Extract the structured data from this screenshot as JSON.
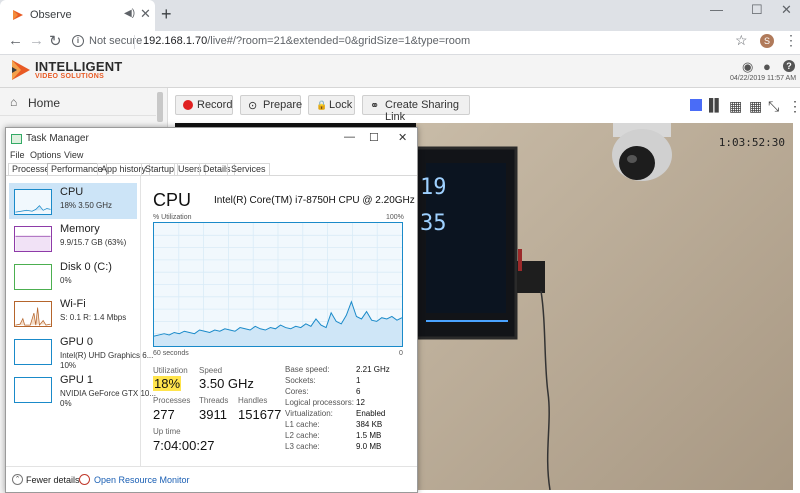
{
  "browser": {
    "tab_title": "Observe",
    "new_tab_glyph": "+",
    "tab_close_glyph": "✕",
    "audio_glyph": "◀)",
    "window_controls": [
      "—",
      "☐",
      "✕"
    ],
    "nav": {
      "back": "←",
      "forward": "→",
      "reload": "↻"
    },
    "security_label": "Not secure",
    "url_host": "192.168.1.70",
    "url_rest": "/live#/?room=21&extended=0&gridSize=1&type=room",
    "star_glyph": "☆",
    "profile_initial": "S",
    "menu_glyph": "⋮"
  },
  "app": {
    "brand_line1": "INTELLIGENT",
    "brand_line2": "VIDEO SOLUTIONS",
    "header_icons": [
      "eye-icon",
      "user-icon",
      "help-icon"
    ],
    "eye_glyph": "◉",
    "user_glyph": "●",
    "help_glyph": "?",
    "datetime": "04/22/2019 11:57 AM",
    "sidebar": {
      "home_label": "Home",
      "home_glyph": "⌂"
    },
    "actions": {
      "record": "Record",
      "prepare": "Prepare",
      "lock": "Lock",
      "share": "Create Sharing Link",
      "prepare_glyph": "⊙",
      "lock_glyph": "🔒",
      "share_glyph": "⚭"
    },
    "grid_glyphs": [
      "■",
      "▌▌",
      "▦",
      "▦",
      "⤡",
      "⋮"
    ],
    "video": {
      "timestamp": "1:03:52:30",
      "tv_line1": "19",
      "tv_line2": "35"
    },
    "colors": {
      "record_red": "#e02020",
      "grid_active": "#4a6cf7",
      "brand_orange": "#e85a24"
    }
  },
  "taskmanager": {
    "title": "Task Manager",
    "window_controls": [
      "—",
      "☐",
      "✕"
    ],
    "menu": [
      "File",
      "Options",
      "View"
    ],
    "tabs": [
      "Processes",
      "Performance",
      "App history",
      "Startup",
      "Users",
      "Details",
      "Services"
    ],
    "resources": [
      {
        "name": "CPU",
        "sub": "18%  3.50 GHz",
        "sub2": ""
      },
      {
        "name": "Memory",
        "sub": "9.9/15.7 GB (63%)",
        "sub2": ""
      },
      {
        "name": "Disk 0 (C:)",
        "sub": "0%",
        "sub2": ""
      },
      {
        "name": "Wi-Fi",
        "sub": "S: 0.1  R: 1.4 Mbps",
        "sub2": ""
      },
      {
        "name": "GPU 0",
        "sub": "Intel(R) UHD Graphics 6...",
        "sub2": "10%"
      },
      {
        "name": "GPU 1",
        "sub": "NVIDIA GeForce GTX 10...",
        "sub2": "0%"
      }
    ],
    "cpu": {
      "title": "CPU",
      "model": "Intel(R) Core(TM) i7-8750H CPU @ 2.20GHz",
      "util_label": "% Utilization",
      "util_max": "100%",
      "graph_left": "60 seconds",
      "graph_right": "0",
      "utilization_label": "Utilization",
      "utilization": "18%",
      "speed_label": "Speed",
      "speed": "3.50 GHz",
      "processes_label": "Processes",
      "processes": "277",
      "threads_label": "Threads",
      "threads": "3911",
      "handles_label": "Handles",
      "handles": "151677",
      "uptime_label": "Up time",
      "uptime": "7:04:00:27",
      "specs": [
        {
          "label": "Base speed:",
          "value": "2.21 GHz"
        },
        {
          "label": "Sockets:",
          "value": "1"
        },
        {
          "label": "Cores:",
          "value": "6"
        },
        {
          "label": "Logical processors:",
          "value": "12"
        },
        {
          "label": "Virtualization:",
          "value": "Enabled"
        },
        {
          "label": "L1 cache:",
          "value": "384 KB"
        },
        {
          "label": "L2 cache:",
          "value": "1.5 MB"
        },
        {
          "label": "L3 cache:",
          "value": "9.0 MB"
        }
      ],
      "graph_values": [
        8,
        9,
        10,
        9,
        11,
        10,
        12,
        11,
        10,
        13,
        12,
        11,
        13,
        12,
        14,
        13,
        12,
        15,
        14,
        13,
        16,
        14,
        13,
        15,
        14,
        17,
        15,
        14,
        16,
        15,
        18,
        16,
        22,
        17,
        15,
        27,
        20,
        18,
        25,
        36,
        24,
        22,
        28,
        21,
        20,
        23,
        22,
        24,
        21,
        23
      ]
    },
    "footer": {
      "fewer": "Fewer details",
      "orm": "Open Resource Monitor",
      "fewer_glyph": "⌃"
    }
  }
}
